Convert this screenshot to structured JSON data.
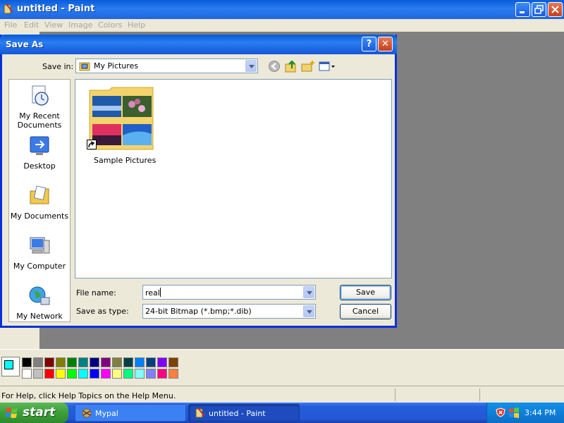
{
  "paint_window": {
    "title": "untitled - Paint",
    "menu": [
      "File",
      "Edit",
      "View",
      "Image",
      "Colors",
      "Help"
    ],
    "status_text": "For Help, click Help Topics on the Help Menu."
  },
  "dialog": {
    "title": "Save As",
    "help_glyph": "?",
    "close_glyph": "✕",
    "save_in_label": "Save in:",
    "save_in_value": "My Pictures",
    "places": [
      "My Recent Documents",
      "Desktop",
      "My Documents",
      "My Computer",
      "My Network"
    ],
    "files": [
      {
        "name": "Sample Pictures",
        "type": "folder-shortcut"
      }
    ],
    "file_name_label": "File name:",
    "file_name_value": "real",
    "save_type_label": "Save as type:",
    "save_type_value": "24-bit Bitmap (*.bmp;*.dib)",
    "save_label": "Save",
    "cancel_label": "Cancel"
  },
  "palette": {
    "foreground": "#00ffff",
    "background": "#ffffff",
    "row1": [
      "#000000",
      "#808080",
      "#800000",
      "#808000",
      "#008000",
      "#008080",
      "#000080",
      "#800080",
      "#808040",
      "#004040",
      "#0080ff",
      "#004080",
      "#8000ff",
      "#804000"
    ],
    "row2": [
      "#ffffff",
      "#c0c0c0",
      "#ff0000",
      "#ffff00",
      "#00ff00",
      "#00ffff",
      "#0000ff",
      "#ff00ff",
      "#ffff80",
      "#00ff80",
      "#80ffff",
      "#8080ff",
      "#ff0080",
      "#ff8040"
    ]
  },
  "taskbar": {
    "start_label": "start",
    "tasks": [
      {
        "label": "Mypal",
        "active": false
      },
      {
        "label": "untitled - Paint",
        "active": true
      }
    ],
    "clock": "3:44 PM"
  }
}
